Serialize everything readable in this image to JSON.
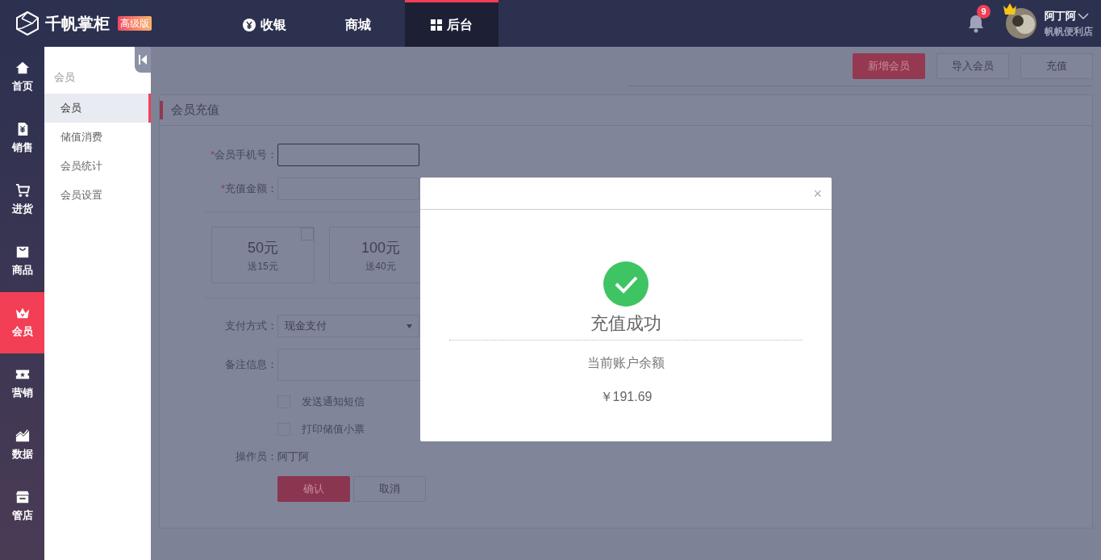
{
  "header": {
    "logo": "千帆掌柜",
    "edition": "高级版",
    "tabs": [
      {
        "label": "收银",
        "selected": false
      },
      {
        "label": "商城",
        "selected": false
      },
      {
        "label": "后台",
        "selected": true
      }
    ],
    "notification_count": "9",
    "user": {
      "name": "阿丁阿",
      "shop": "帆帆便利店"
    }
  },
  "sidebar": {
    "items": [
      {
        "label": "首页",
        "selected": false
      },
      {
        "label": "销售",
        "selected": false
      },
      {
        "label": "进货",
        "selected": false
      },
      {
        "label": "商品",
        "selected": false
      },
      {
        "label": "会员",
        "selected": true
      },
      {
        "label": "营销",
        "selected": false
      },
      {
        "label": "数据",
        "selected": false
      },
      {
        "label": "管店",
        "selected": false
      }
    ]
  },
  "submenu": {
    "title": "会员",
    "items": [
      {
        "label": "会员",
        "selected": true
      },
      {
        "label": "储值消费",
        "selected": false
      },
      {
        "label": "会员统计",
        "selected": false
      },
      {
        "label": "会员设置",
        "selected": false
      }
    ]
  },
  "toolbar": {
    "buttons": [
      {
        "label": "新增会员",
        "primary": true
      },
      {
        "label": "导入会员",
        "primary": false
      },
      {
        "label": "充值",
        "primary": false
      }
    ]
  },
  "form": {
    "title": "会员充值",
    "phone_label": "会员手机号：",
    "amount_label": "充值金额：",
    "required_mark": "*",
    "packages": [
      {
        "amount": "50元",
        "bonus": "送15元",
        "checked": false
      },
      {
        "amount": "100元",
        "bonus": "送40元"
      }
    ],
    "payment_label": "支付方式：",
    "payment_value": "现金支付",
    "note_label": "备注信息：",
    "options": [
      {
        "label": "发送通知短信",
        "checked": false
      },
      {
        "label": "打印储值小票",
        "checked": false
      }
    ],
    "operator_label": "操作员：",
    "operator": "阿丁阿",
    "confirm": "确认",
    "cancel": "取消"
  },
  "modal": {
    "close": "×",
    "title": "充值成功",
    "balance_label": "当前账户余额",
    "balance": "￥191.69"
  }
}
